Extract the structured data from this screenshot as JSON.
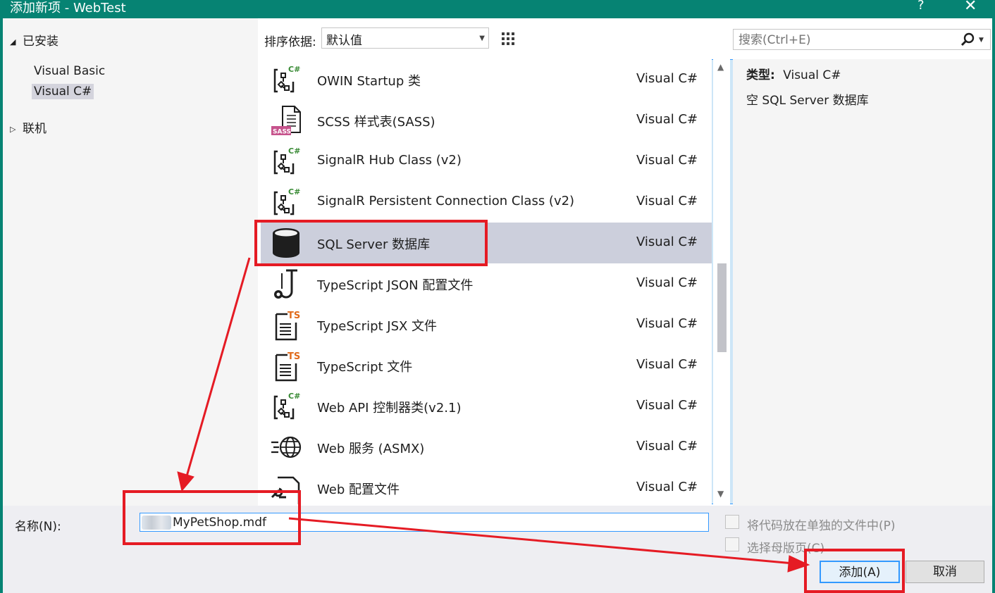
{
  "window": {
    "title": "添加新项 - WebTest",
    "help_label": "?",
    "close_label": "✕"
  },
  "tree": {
    "installed_label": "已安装",
    "items": [
      {
        "label": "Visual Basic",
        "selected": false
      },
      {
        "label": "Visual C#",
        "selected": true
      }
    ],
    "online_label": "联机"
  },
  "toolbar": {
    "sort_label": "排序依据:",
    "sort_value": "默认值",
    "search_placeholder": "搜索(Ctrl+E)"
  },
  "templates": [
    {
      "name": "OWIN Startup 类",
      "lang": "Visual C#",
      "icon": "csharp-class-icon",
      "selected": false
    },
    {
      "name": "SCSS 样式表(SASS)",
      "lang": "Visual C#",
      "icon": "sass-file-icon",
      "selected": false
    },
    {
      "name": "SignalR Hub Class (v2)",
      "lang": "Visual C#",
      "icon": "csharp-class-icon",
      "selected": false
    },
    {
      "name": "SignalR Persistent Connection Class (v2)",
      "lang": "Visual C#",
      "icon": "csharp-class-icon",
      "selected": false
    },
    {
      "name": "SQL Server 数据库",
      "lang": "Visual C#",
      "icon": "database-icon",
      "selected": true
    },
    {
      "name": "TypeScript JSON 配置文件",
      "lang": "Visual C#",
      "icon": "json-config-icon",
      "selected": false
    },
    {
      "name": "TypeScript JSX 文件",
      "lang": "Visual C#",
      "icon": "typescript-file-icon",
      "selected": false
    },
    {
      "name": "TypeScript 文件",
      "lang": "Visual C#",
      "icon": "typescript-file-icon",
      "selected": false
    },
    {
      "name": "Web API 控制器类(v2.1)",
      "lang": "Visual C#",
      "icon": "csharp-class-icon",
      "selected": false
    },
    {
      "name": "Web 服务 (ASMX)",
      "lang": "Visual C#",
      "icon": "web-service-icon",
      "selected": false
    },
    {
      "name": "Web 配置文件",
      "lang": "Visual C#",
      "icon": "web-config-icon",
      "selected": false
    }
  ],
  "details": {
    "type_label": "类型:",
    "type_value": "Visual C#",
    "description": "空 SQL Server 数据库"
  },
  "footer": {
    "name_label": "名称(N):",
    "name_value": "MyPetShop.mdf",
    "option1_label": "将代码放在单独的文件中(P)",
    "option2_label": "选择母版页(C)",
    "add_label": "添加(A)",
    "cancel_label": "取消"
  },
  "colors": {
    "title_bar": "#068373",
    "selection": "#cccfdc",
    "annotation_red": "#e51b24",
    "focus_blue": "#3399ff"
  }
}
